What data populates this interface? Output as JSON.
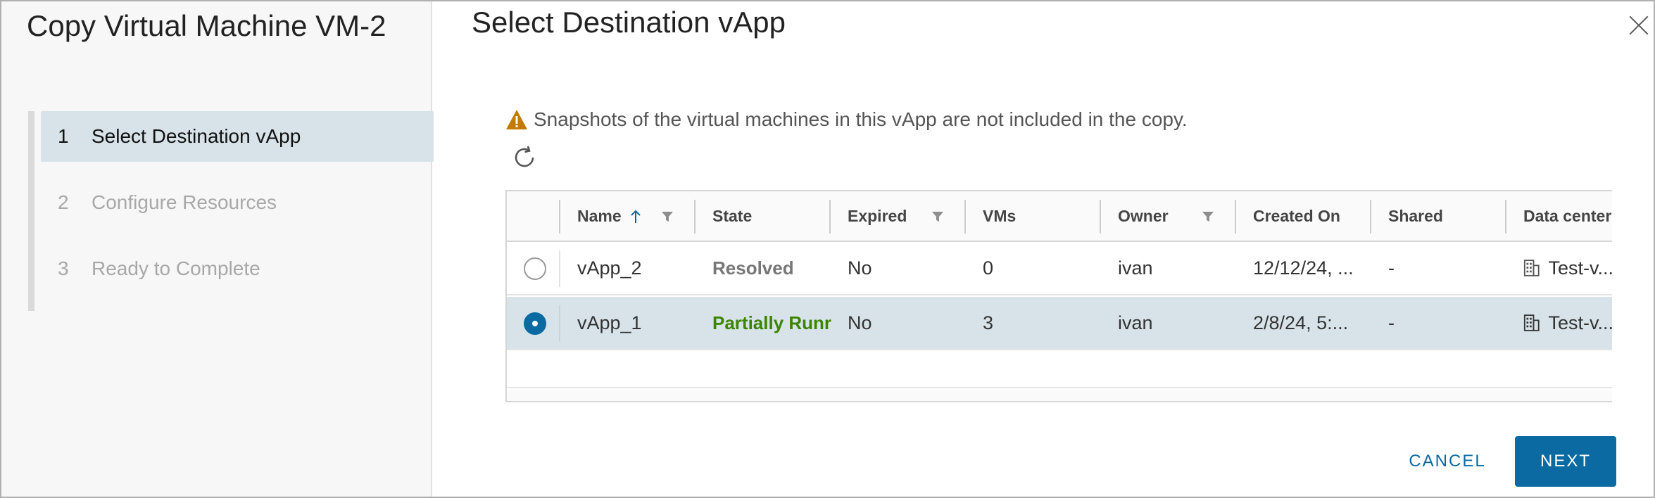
{
  "wizard": {
    "title": "Copy Virtual Machine VM-2",
    "steps": [
      {
        "num": "1",
        "label": "Select Destination vApp",
        "state": "active"
      },
      {
        "num": "2",
        "label": "Configure Resources",
        "state": "inactive"
      },
      {
        "num": "3",
        "label": "Ready to Complete",
        "state": "inactive"
      }
    ]
  },
  "main": {
    "title": "Select Destination vApp",
    "warning": "Snapshots of the virtual machines in this vApp are not included in the copy.",
    "warning_icon": "warning-triangle-icon",
    "warning_color": "#c27b00",
    "refresh_icon": "refresh-icon"
  },
  "grid": {
    "columns": [
      "Name",
      "State",
      "Expired",
      "VMs",
      "Owner",
      "Created On",
      "Shared",
      "Data center"
    ],
    "sort": {
      "column": "Name",
      "direction": "ascending"
    },
    "filterable": [
      "Name",
      "Expired",
      "Owner"
    ],
    "rows": [
      {
        "selected": false,
        "name": "vApp_2",
        "state": "Resolved",
        "expired": "No",
        "vms": "0",
        "owner": "ivan",
        "created_on": "12/12/24, ...",
        "shared": "-",
        "data_center": "Test-v..."
      },
      {
        "selected": true,
        "name": "vApp_1",
        "state": "Partially Runr",
        "expired": "No",
        "vms": "3",
        "owner": "ivan",
        "created_on": "2/8/24, 5:...",
        "shared": "-",
        "data_center": "Test-v..."
      }
    ]
  },
  "buttons": {
    "cancel": "CANCEL",
    "next": "NEXT"
  },
  "colors": {
    "accent": "#0b6aa2",
    "selected_row": "#d8e3e9",
    "state_running": "#3c8500"
  }
}
